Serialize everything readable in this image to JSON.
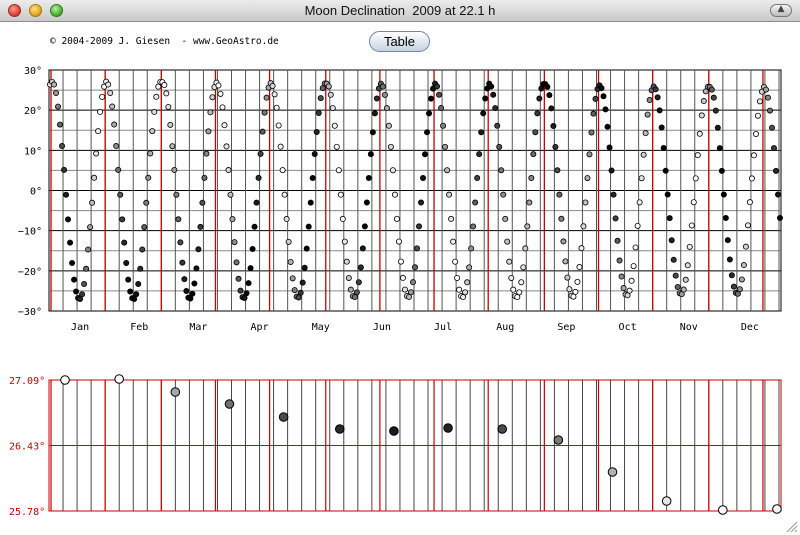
{
  "window": {
    "title": "Moon Declination  2009 at 22.1 h"
  },
  "header": {
    "copyright": "© 2004-2009 J. Giesen  - www.GeoAstro.de",
    "table_button": "Table"
  },
  "colors": {
    "grid_red": "#cc0000",
    "grid_gray": "#555555",
    "label_red": "#cc0000"
  },
  "icons": {
    "toolbar": "toolbar-toggle-icon",
    "resize": "resize-grip-icon"
  },
  "chart_data": [
    {
      "type": "scatter",
      "title": "",
      "xlabel": "",
      "ylabel": "",
      "months": [
        "Jan",
        "Feb",
        "Mar",
        "Apr",
        "May",
        "Jun",
        "Jul",
        "Aug",
        "Sep",
        "Oct",
        "Nov",
        "Dec"
      ],
      "ylim": [
        -30,
        30
      ],
      "y_ticks": [
        "30°",
        "20°",
        "10°",
        "0°",
        "−10°",
        "−20°",
        "−30°"
      ],
      "grid": true,
      "note": "daily declination of the Moon at 22.1 h, markers shaded by lunar phase",
      "major_standstills": [
        {
          "date": "2009-01-02",
          "value": 27.09
        },
        {
          "date": "2009-01-29",
          "value": 27.1
        },
        {
          "date": "2009-02-26",
          "value": 26.97
        },
        {
          "date": "2009-03-25",
          "value": 26.85
        },
        {
          "date": "2009-04-21",
          "value": 26.72
        },
        {
          "date": "2009-05-19",
          "value": 26.6
        },
        {
          "date": "2009-06-15",
          "value": 26.58
        },
        {
          "date": "2009-07-12",
          "value": 26.61
        },
        {
          "date": "2009-08-08",
          "value": 26.6
        },
        {
          "date": "2009-09-05",
          "value": 26.49
        },
        {
          "date": "2009-10-02",
          "value": 26.17
        },
        {
          "date": "2009-10-29",
          "value": 25.88
        },
        {
          "date": "2009-11-26",
          "value": 25.79
        },
        {
          "date": "2009-12-23",
          "value": 25.8
        }
      ]
    },
    {
      "type": "scatter",
      "title": "",
      "xlabel": "",
      "ylabel": "",
      "ylim": [
        25.78,
        27.09
      ],
      "y_ticks": [
        "27.09°",
        "26.43°",
        "25.78°"
      ],
      "grid": true,
      "points": [
        {
          "date": "2009-01-02",
          "value": 27.09,
          "shade": "#ffffff"
        },
        {
          "date": "2009-01-29",
          "value": 27.1,
          "shade": "#ffffff"
        },
        {
          "date": "2009-02-26",
          "value": 26.97,
          "shade": "#a6a6a6"
        },
        {
          "date": "2009-03-25",
          "value": 26.85,
          "shade": "#707070"
        },
        {
          "date": "2009-04-21",
          "value": 26.72,
          "shade": "#4a4a4a"
        },
        {
          "date": "2009-05-19",
          "value": 26.6,
          "shade": "#2a2a2a"
        },
        {
          "date": "2009-06-15",
          "value": 26.58,
          "shade": "#1a1a1a"
        },
        {
          "date": "2009-07-12",
          "value": 26.61,
          "shade": "#222222"
        },
        {
          "date": "2009-08-08",
          "value": 26.6,
          "shade": "#4a4a4a"
        },
        {
          "date": "2009-09-05",
          "value": 26.49,
          "shade": "#777777"
        },
        {
          "date": "2009-10-02",
          "value": 26.17,
          "shade": "#b0b0b0"
        },
        {
          "date": "2009-10-29",
          "value": 25.88,
          "shade": "#e6e6e6"
        },
        {
          "date": "2009-11-26",
          "value": 25.79,
          "shade": "#ffffff"
        },
        {
          "date": "2009-12-23",
          "value": 25.8,
          "shade": "#f2f2f2"
        }
      ]
    }
  ]
}
